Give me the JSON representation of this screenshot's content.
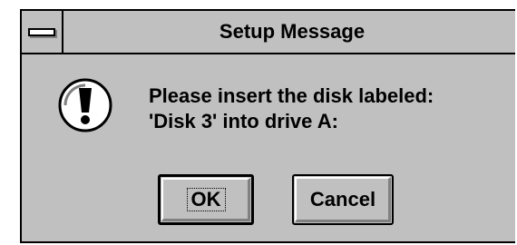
{
  "window": {
    "title": "Setup Message",
    "system_menu_icon": "system-menu-icon"
  },
  "message": {
    "icon": "exclamation-icon",
    "line1": "Please insert the disk labeled:",
    "line2": "'Disk 3' into drive A:"
  },
  "buttons": {
    "ok_label": "OK",
    "cancel_label": "Cancel"
  },
  "colors": {
    "face": "#c0c0c0",
    "highlight": "#ffffff",
    "shadow": "#808080",
    "text": "#000000"
  }
}
